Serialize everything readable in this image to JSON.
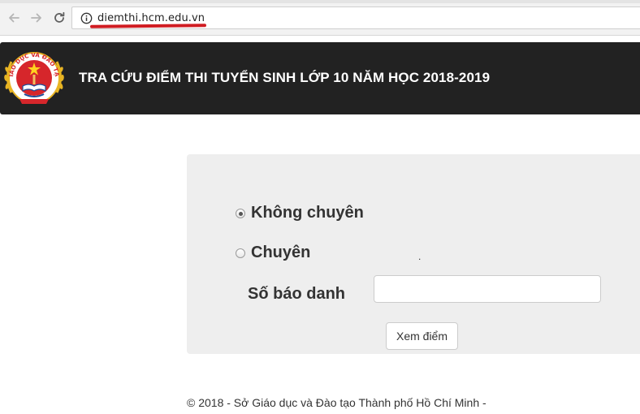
{
  "browser": {
    "url": "diemthi.hcm.edu.vn"
  },
  "header": {
    "title": "TRA CỨU ĐIỂM THI TUYỂN SINH LỚP 10 NĂM HỌC 2018-2019",
    "logo_text": "GIÁO DỤC VÀ ĐÀO TẠO"
  },
  "form": {
    "options": [
      {
        "label": "Không chuyên",
        "checked": true
      },
      {
        "label": "Chuyên",
        "checked": false
      }
    ],
    "stray_mark": ".",
    "candidate_number_label": "Số báo danh",
    "candidate_number_value": "",
    "submit_label": "Xem điểm"
  },
  "footer": {
    "text": "© 2018 - Sở Giáo dục và Đào tạo Thành phố Hồ Chí Minh -"
  },
  "colors": {
    "banner": "#222222",
    "panel": "#eeeeee",
    "url_underline": "#d01c22",
    "logo_red": "#d6262b",
    "logo_gold": "#e8b423"
  }
}
